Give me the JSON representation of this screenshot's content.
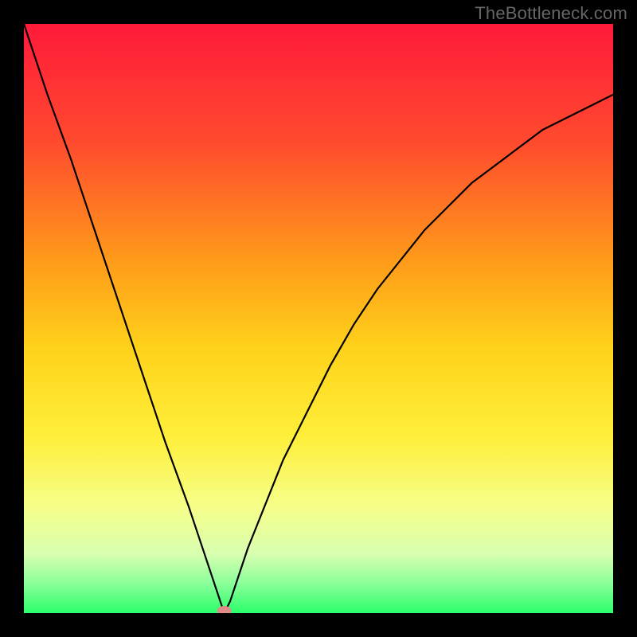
{
  "watermark": "TheBottleneck.com",
  "chart_data": {
    "type": "line",
    "title": "",
    "xlabel": "",
    "ylabel": "",
    "xlim": [
      0,
      1
    ],
    "ylim": [
      0,
      1
    ],
    "vertex_x": 0.34,
    "marker": {
      "x": 0.34,
      "y": 0.0,
      "color": "#e08a8a"
    },
    "series": [
      {
        "name": "curve",
        "x": [
          0.0,
          0.04,
          0.08,
          0.12,
          0.16,
          0.2,
          0.24,
          0.28,
          0.3,
          0.32,
          0.33,
          0.34,
          0.35,
          0.36,
          0.38,
          0.4,
          0.44,
          0.48,
          0.52,
          0.56,
          0.6,
          0.64,
          0.68,
          0.72,
          0.76,
          0.8,
          0.84,
          0.88,
          0.92,
          0.96,
          1.0
        ],
        "y": [
          1.0,
          0.88,
          0.77,
          0.65,
          0.53,
          0.41,
          0.29,
          0.18,
          0.12,
          0.06,
          0.03,
          0.0,
          0.02,
          0.05,
          0.11,
          0.16,
          0.26,
          0.34,
          0.42,
          0.49,
          0.55,
          0.6,
          0.65,
          0.69,
          0.73,
          0.76,
          0.79,
          0.82,
          0.84,
          0.86,
          0.88
        ]
      }
    ],
    "gradient_stops": [
      {
        "offset": 0.0,
        "color": "#ff1a3a"
      },
      {
        "offset": 0.2,
        "color": "#ff4a2e"
      },
      {
        "offset": 0.4,
        "color": "#ff9a1a"
      },
      {
        "offset": 0.55,
        "color": "#ffd21a"
      },
      {
        "offset": 0.7,
        "color": "#ffef3a"
      },
      {
        "offset": 0.82,
        "color": "#f6ff8a"
      },
      {
        "offset": 0.9,
        "color": "#d8ffb0"
      },
      {
        "offset": 0.95,
        "color": "#8aff9a"
      },
      {
        "offset": 1.0,
        "color": "#2aff6a"
      }
    ]
  }
}
